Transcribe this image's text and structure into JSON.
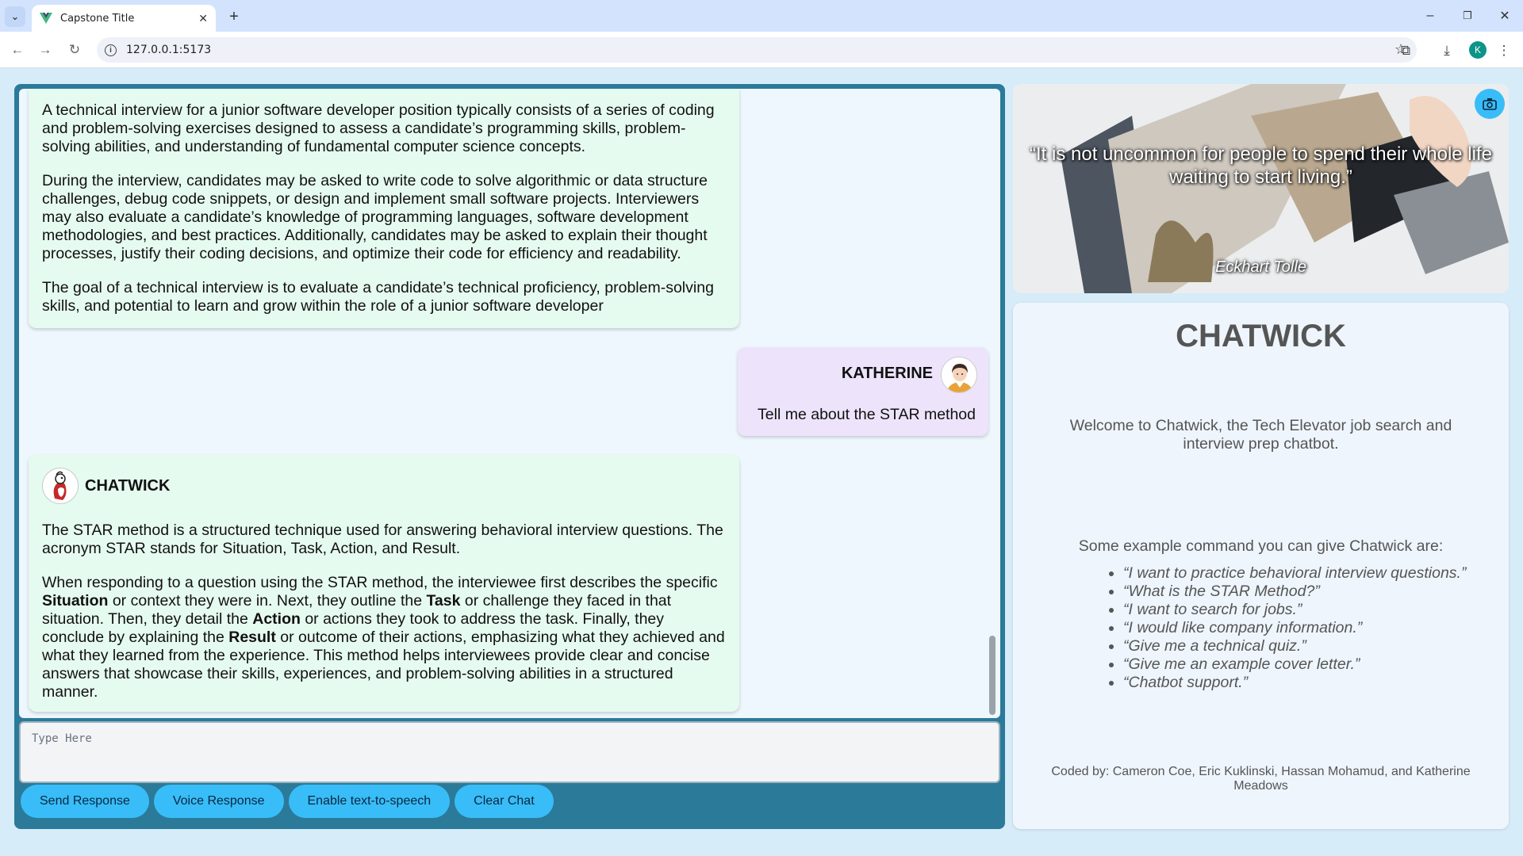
{
  "browser": {
    "tab_title": "Capstone Title",
    "url": "127.0.0.1:5173",
    "profile_initial": "K"
  },
  "chat": {
    "messages": [
      {
        "sender": "",
        "paragraphs": [
          "A technical interview for a junior software developer position typically consists of a series of coding and problem-solving exercises designed to assess a candidate’s programming skills, problem-solving abilities, and understanding of fundamental computer science concepts.",
          "During the interview, candidates may be asked to write code to solve algorithmic or data structure challenges, debug code snippets, or design and implement small software projects. Interviewers may also evaluate a candidate’s knowledge of programming languages, software development methodologies, and best practices. Additionally, candidates may be asked to explain their thought processes, justify their coding decisions, and optimize their code for efficiency and readability.",
          "The goal of a technical interview is to evaluate a candidate’s technical proficiency, problem-solving skills, and potential to learn and grow within the role of a junior software developer"
        ]
      },
      {
        "sender": "KATHERINE",
        "text": "Tell me about the STAR method"
      },
      {
        "sender": "CHATWICK",
        "p1": "The STAR method is a structured technique used for answering behavioral interview questions. The acronym STAR stands for Situation, Task, Action, and Result.",
        "p2": [
          "When responding to a question using the STAR method, the interviewee first describes the specific ",
          "Situation",
          " or context they were in. Next, they outline the ",
          "Task",
          " or challenge they faced in that situation. Then, they detail the ",
          "Action",
          " or actions they took to address the task. Finally, they conclude by explaining the ",
          "Result",
          " or outcome of their actions, emphasizing what they achieved and what they learned from the experience. This method helps interviewees provide clear and concise answers that showcase their skills, experiences, and problem-solving abilities in a structured manner."
        ]
      }
    ],
    "input_placeholder": "Type Here",
    "buttons": [
      "Send Response",
      "Voice Response",
      "Enable text-to-speech",
      "Clear Chat"
    ]
  },
  "quote": {
    "text": "“It is not uncommon for people to spend their whole life waiting to start living.”",
    "author": "Eckhart Tolle"
  },
  "info": {
    "title": "CHATWICK",
    "welcome": "Welcome to Chatwick, the Tech Elevator job search and interview prep chatbot.",
    "examples_heading": "Some example command you can give Chatwick are:",
    "examples": [
      "“I want to practice behavioral interview questions.”",
      "“What is the STAR Method?”",
      "“I want to search for jobs.”",
      "“I would like company information.”",
      "“Give me a technical quiz.”",
      "“Give me an example cover letter.”",
      "“Chatbot support.”"
    ],
    "credit": "Coded by: Cameron Coe, Eric Kuklinski, Hassan Mohamud, and Katherine Meadows"
  }
}
